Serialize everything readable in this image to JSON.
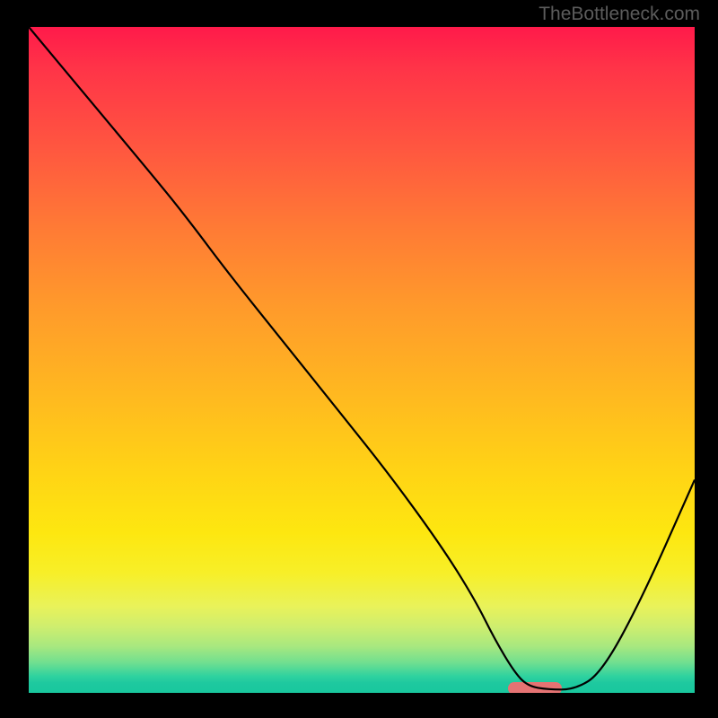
{
  "watermark": "TheBottleneck.com",
  "chart_data": {
    "type": "line",
    "title": "",
    "xlabel": "",
    "ylabel": "",
    "xlim": [
      0,
      100
    ],
    "ylim": [
      0,
      100
    ],
    "x": [
      0,
      10,
      20,
      24,
      30,
      38,
      46,
      54,
      62,
      67,
      70,
      73,
      75,
      78,
      82,
      86,
      92,
      100
    ],
    "values": [
      100,
      88,
      76,
      71,
      63,
      53,
      43,
      33,
      22,
      14,
      8,
      3,
      1,
      0.5,
      0.5,
      3,
      14,
      32
    ],
    "marker": {
      "x_start": 72,
      "x_end": 80,
      "y": 0.7
    },
    "gradient_stops": [
      {
        "pos": 0,
        "color": "#ff1a4a"
      },
      {
        "pos": 50,
        "color": "#ffa028"
      },
      {
        "pos": 80,
        "color": "#f7ef28"
      },
      {
        "pos": 100,
        "color": "#19c79e"
      }
    ]
  }
}
